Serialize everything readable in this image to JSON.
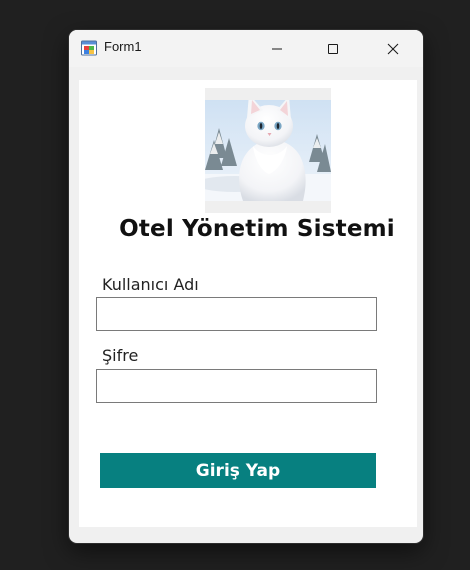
{
  "window": {
    "title": "Form1",
    "app_icon": "winforms-app-icon",
    "controls": {
      "minimize_icon": "minimize-icon",
      "maximize_icon": "maximize-icon",
      "close_icon": "close-icon"
    }
  },
  "form": {
    "image": "white-cat-picture",
    "heading": "Otel Yönetim Sistemi",
    "username": {
      "label": "Kullanıcı Adı",
      "value": ""
    },
    "password": {
      "label": "Şifre",
      "value": ""
    },
    "login_button": "Giriş Yap"
  },
  "colors": {
    "button_bg": "#078080",
    "button_text": "#ffffff",
    "client_bg": "#ffffff",
    "window_bg": "#f0f0f0"
  }
}
